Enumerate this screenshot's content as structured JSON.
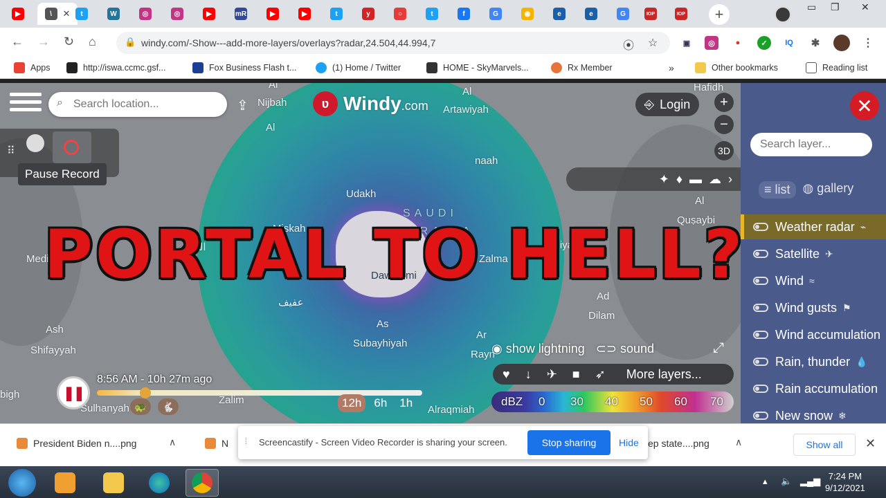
{
  "browser": {
    "tabs": [
      {
        "icon": "youtube-icon",
        "color": "#ff0000",
        "glyph": "▶"
      },
      {
        "icon": "active-tab-icon",
        "color": "#555555",
        "glyph": "\\"
      },
      {
        "icon": "twitter-icon",
        "color": "#1da1f2",
        "glyph": "t"
      },
      {
        "icon": "wordpress-icon",
        "color": "#21759b",
        "glyph": "W"
      },
      {
        "icon": "instagram-icon",
        "color": "#c13584",
        "glyph": "◎"
      },
      {
        "icon": "instagram-icon",
        "color": "#c13584",
        "glyph": "◎"
      },
      {
        "icon": "youtube-icon",
        "color": "#ff0000",
        "glyph": "▶"
      },
      {
        "icon": "mr-icon",
        "color": "#34489a",
        "glyph": "mR"
      },
      {
        "icon": "youtube-icon",
        "color": "#ff0000",
        "glyph": "▶"
      },
      {
        "icon": "youtube-icon",
        "color": "#ff0000",
        "glyph": "▶"
      },
      {
        "icon": "twitter-icon",
        "color": "#1da1f2",
        "glyph": "t"
      },
      {
        "icon": "yelp-icon",
        "color": "#d32323",
        "glyph": "y"
      },
      {
        "icon": "chat-icon",
        "color": "#e43b3b",
        "glyph": "○"
      },
      {
        "icon": "twitter-icon",
        "color": "#1da1f2",
        "glyph": "t"
      },
      {
        "icon": "facebook-icon",
        "color": "#1877f2",
        "glyph": "f"
      },
      {
        "icon": "google-icon",
        "color": "#4285f4",
        "glyph": "G"
      },
      {
        "icon": "photos-icon",
        "color": "#f4b400",
        "glyph": "◉"
      },
      {
        "icon": "ie-icon",
        "color": "#1b5fa8",
        "glyph": "e"
      },
      {
        "icon": "ie-icon",
        "color": "#1b5fa8",
        "glyph": "e"
      },
      {
        "icon": "google-icon",
        "color": "#4285f4",
        "glyph": "G"
      },
      {
        "icon": "iop-icon",
        "color": "#c62828",
        "glyph": "IOP"
      },
      {
        "icon": "iop-icon",
        "color": "#c62828",
        "glyph": "IOP"
      }
    ],
    "active_tab_close": "✕",
    "new_tab": "+",
    "url": "windy.com/-Show---add-more-layers/overlays?radar,24.504,44.994,7"
  },
  "bookmarks": [
    {
      "label": "Apps",
      "color": "#e94235"
    },
    {
      "label": "http://iswa.ccmc.gsf...",
      "color": "#222222"
    },
    {
      "label": "Fox Business Flash t...",
      "color": "#1c3f94"
    },
    {
      "label": "(1) Home / Twitter",
      "color": "#1da1f2"
    },
    {
      "label": "HOME - SkyMarvels...",
      "color": "#333333"
    },
    {
      "label": "Rx Member",
      "color": "#e8743b"
    }
  ],
  "bookmarks_more": "»",
  "other_bookmarks": "Other bookmarks",
  "reading_list": "Reading list",
  "map": {
    "search_placeholder": "Search location...",
    "logo_text": "Windy",
    "logo_suffix": ".com",
    "login": "Login",
    "zoom_in": "+",
    "zoom_out": "−",
    "view_3d": "3D",
    "tooltip": "Pause Record",
    "headline": "PORTAL TO HELL?",
    "places": [
      {
        "text": "Al",
        "tone": "light"
      },
      {
        "text": "Nijbah",
        "tone": "light"
      },
      {
        "text": "Al",
        "tone": "light"
      },
      {
        "text": "Artawiyah",
        "tone": "light"
      },
      {
        "text": "Al",
        "tone": "light"
      },
      {
        "text": "Hafidh",
        "tone": "light"
      },
      {
        "text": "Miskah",
        "tone": "light"
      },
      {
        "text": "SAUDI",
        "tone": "light"
      },
      {
        "text": "ARABIA",
        "tone": "light"
      },
      {
        "text": "Medina",
        "tone": "light"
      },
      {
        "text": "الحسو",
        "tone": "light"
      },
      {
        "text": "Ad",
        "tone": "dark"
      },
      {
        "text": "Dawadimi",
        "tone": "dark"
      },
      {
        "text": "Zalma",
        "tone": "light"
      },
      {
        "text": "Riyadh",
        "tone": "light"
      },
      {
        "text": "Al",
        "tone": "light"
      },
      {
        "text": "Quṣaybi",
        "tone": "light"
      },
      {
        "text": "عفيف",
        "tone": "light"
      },
      {
        "text": "Ad",
        "tone": "light"
      },
      {
        "text": "Dilam",
        "tone": "light"
      },
      {
        "text": "Ash",
        "tone": "light"
      },
      {
        "text": "Shifayyah",
        "tone": "light"
      },
      {
        "text": "As",
        "tone": "light"
      },
      {
        "text": "Subayhiyah",
        "tone": "light"
      },
      {
        "text": "Ar",
        "tone": "light"
      },
      {
        "text": "Rayn",
        "tone": "light"
      },
      {
        "text": "bigh",
        "tone": "light"
      },
      {
        "text": "Sulhanyah",
        "tone": "light"
      },
      {
        "text": "Zalim",
        "tone": "light"
      },
      {
        "text": "Alraqmiah",
        "tone": "light"
      },
      {
        "text": "Udakh",
        "tone": "light"
      },
      {
        "text": "naah",
        "tone": "light"
      }
    ],
    "time_label": "8:56 AM - 10h 27m ago",
    "ranges": [
      {
        "label": "12h",
        "on": true
      },
      {
        "label": "6h",
        "on": false
      },
      {
        "label": "1h",
        "on": false
      }
    ],
    "show_lightning": "show lightning",
    "sound": "sound",
    "more_layers": "More layers...",
    "legend": {
      "unit": "dBZ",
      "ticks": [
        "0",
        "30",
        "40",
        "50",
        "60",
        "70"
      ]
    }
  },
  "panel": {
    "close": "✕",
    "search_placeholder": "Search layer...",
    "view_list": "list",
    "view_gallery": "gallery",
    "layers": [
      {
        "label": "Weather radar",
        "icon": "radar-icon",
        "glyph": "⌁",
        "on": true
      },
      {
        "label": "Satellite",
        "icon": "satellite-icon",
        "glyph": "✈",
        "on": false
      },
      {
        "label": "Wind",
        "icon": "wind-icon",
        "glyph": "≈",
        "on": false
      },
      {
        "label": "Wind gusts",
        "icon": "flag-icon",
        "glyph": "⚑",
        "on": false
      },
      {
        "label": "Wind accumulation",
        "icon": "",
        "glyph": "",
        "on": false
      },
      {
        "label": "Rain, thunder",
        "icon": "drop-icon",
        "glyph": "💧",
        "on": false
      },
      {
        "label": "Rain accumulation",
        "icon": "",
        "glyph": "",
        "on": false
      },
      {
        "label": "New snow",
        "icon": "snow-icon",
        "glyph": "❄",
        "on": false
      }
    ]
  },
  "downloads": {
    "item1": "President Biden n....png",
    "item2": "N",
    "item3": "ep state....png",
    "share_message": "Screencastify - Screen Video Recorder is sharing your screen.",
    "stop_sharing": "Stop sharing",
    "hide": "Hide",
    "show_all": "Show all"
  },
  "taskbar": {
    "time": "7:24 PM",
    "date": "9/12/2021"
  }
}
